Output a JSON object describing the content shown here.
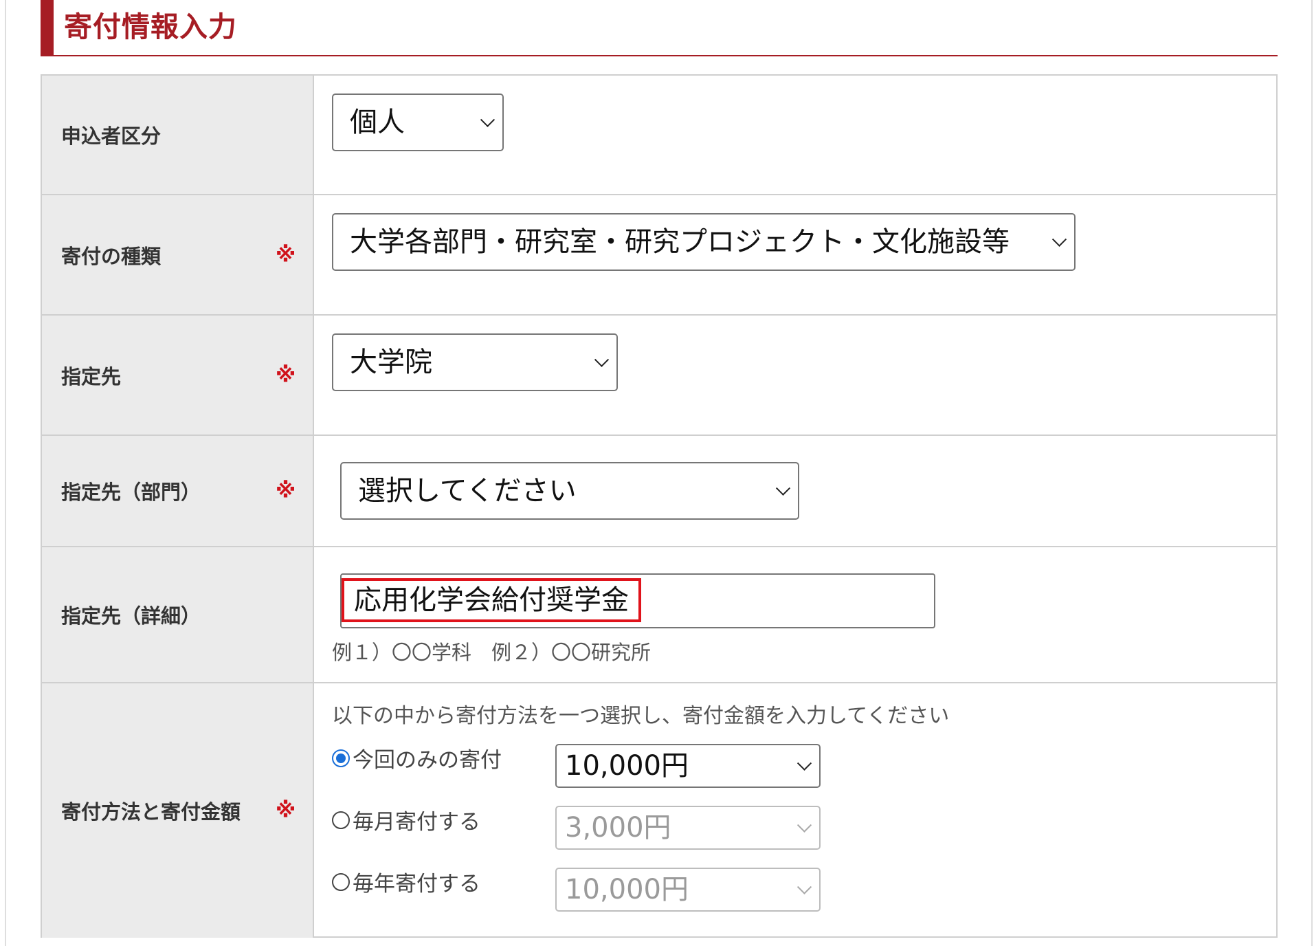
{
  "heading": {
    "title": "寄付情報入力"
  },
  "required_mark": "※",
  "rows": {
    "applicant": {
      "label": "申込者区分",
      "value": "個人"
    },
    "donation_type": {
      "label": "寄付の種類",
      "value": "大学各部門・研究室・研究プロジェクト・文化施設等"
    },
    "designation": {
      "label": "指定先",
      "value": "大学院"
    },
    "designation_dept": {
      "label": "指定先（部門）",
      "value": "選択してください"
    },
    "designation_detail": {
      "label": "指定先（詳細）",
      "value": "応用化学会給付奨学金",
      "hint": "例１）〇〇学科　例２）〇〇研究所"
    },
    "method": {
      "label": "寄付方法と寄付金額",
      "instruction": "以下の中から寄付方法を一つ選択し、寄付金額を入力してください",
      "options": [
        {
          "label": "今回のみの寄付",
          "checked": true,
          "amount": "10,000円",
          "disabled": false
        },
        {
          "label": "毎月寄付する",
          "checked": false,
          "amount": "3,000円",
          "disabled": true
        },
        {
          "label": "毎年寄付する",
          "checked": false,
          "amount": "10,000円",
          "disabled": true
        }
      ]
    }
  },
  "colors": {
    "accent": "#a61d24",
    "required": "#d0121b",
    "highlight": "#e0131b",
    "radio": "#1a6fd8",
    "label_bg": "#ebebeb"
  }
}
